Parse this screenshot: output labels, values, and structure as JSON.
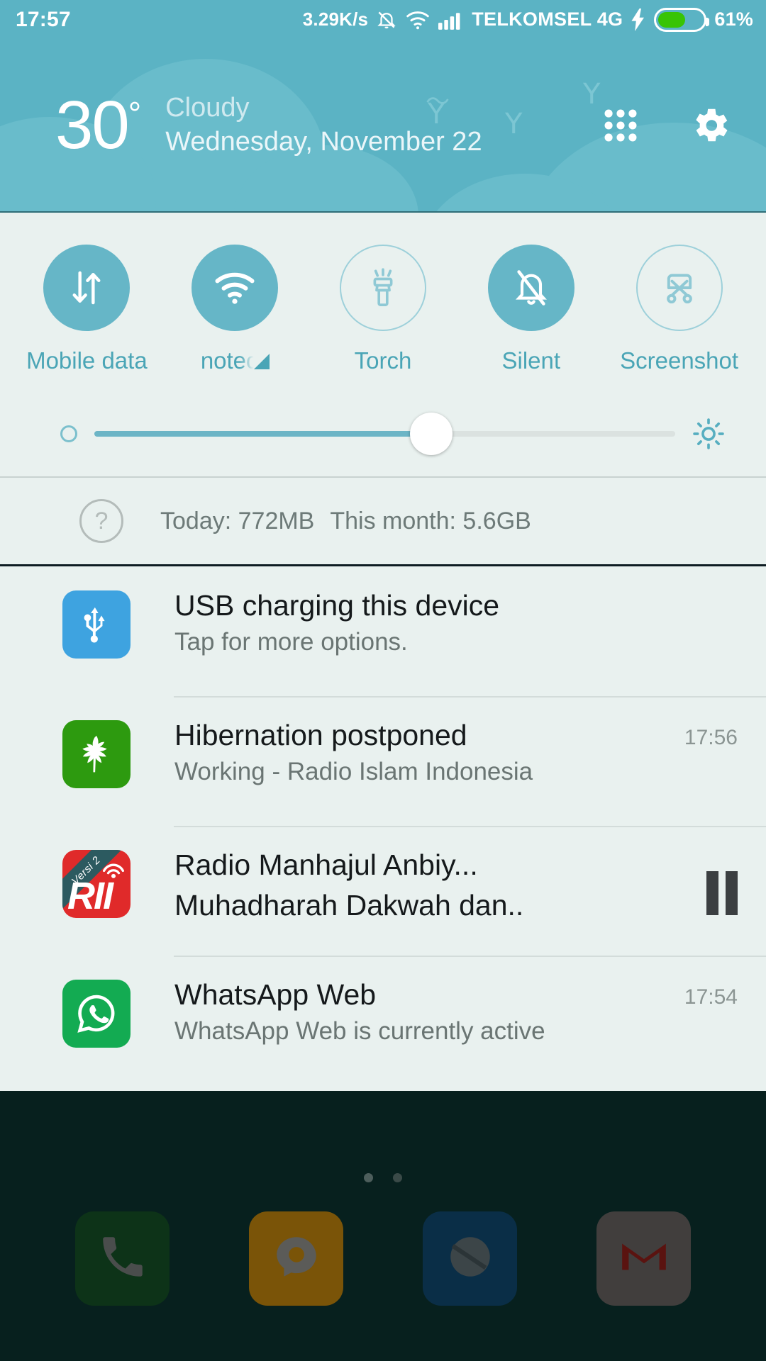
{
  "statusbar": {
    "clock": "17:57",
    "net_speed": "3.29K/s",
    "icons": [
      "silent-bell-icon",
      "wifi-icon",
      "signal-bars-icon"
    ],
    "carrier": "TELKOMSEL 4G",
    "charging_icon": "lightning-bolt-icon",
    "battery_percent": "61%",
    "battery_level": 61,
    "battery_color": "#38c404",
    "background_color": "#5bb3c4",
    "text_color": "#ffffff"
  },
  "weather": {
    "temperature": "30",
    "degree_symbol": "°",
    "condition": "Cloudy",
    "date": "Wednesday, November 22",
    "shortcuts_icon": "app-grid-icon",
    "settings_icon": "gear-icon",
    "background_color": "#5bb3c4"
  },
  "quick_settings": {
    "accent_color": "#66b6c7",
    "label_color": "#4aa5b6",
    "panel_background": "#e9f1ef",
    "tiles": [
      {
        "label": "Mobile data",
        "icon": "mobile-data-arrows-icon",
        "state": "on"
      },
      {
        "label": "notec",
        "icon": "wifi-icon",
        "state": "on"
      },
      {
        "label": "Torch",
        "icon": "flashlight-icon",
        "state": "off"
      },
      {
        "label": "Silent",
        "icon": "bell-slash-icon",
        "state": "on"
      },
      {
        "label": "Screenshot",
        "icon": "scissors-crop-icon",
        "state": "off"
      }
    ],
    "brightness": {
      "value_percent": 58,
      "low_icon": "brightness-low-icon",
      "high_icon": "brightness-high-sun-icon"
    },
    "data_usage": {
      "help_icon": "question-mark-icon",
      "today_label": "Today: 772MB",
      "month_label": "This month: 5.6GB"
    }
  },
  "notifications": [
    {
      "app_icon": "usb-icon",
      "icon_color": "#3ea3e0",
      "title": "USB charging this device",
      "text": "Tap for more options.",
      "time": "",
      "action": ""
    },
    {
      "app_icon": "leaf-icon",
      "icon_color": "#2d9a0f",
      "title": "Hibernation postponed",
      "text": "Working - Radio Islam Indonesia",
      "time": "17:56",
      "action": ""
    },
    {
      "app_icon": "rii-radio-icon",
      "icon_color": "#e02a2a",
      "icon_badge": "Versi 2",
      "icon_text": "RII",
      "title": "Radio Manhajul Anbiy...",
      "text": "Muhadharah Dakwah dan..",
      "time": "",
      "action": "pause-button"
    },
    {
      "app_icon": "whatsapp-icon",
      "icon_color": "#13ab52",
      "title": "WhatsApp Web",
      "text": "WhatsApp Web is currently active",
      "time": "17:54",
      "action": ""
    }
  ],
  "homescreen": {
    "page_dots": 2,
    "active_dot_index": 0,
    "dock": [
      {
        "label": "phone",
        "icon": "phone-icon",
        "color": "#0d3318"
      },
      {
        "label": "messaging",
        "icon": "message-bubble-icon",
        "color": "#7a5408"
      },
      {
        "label": "browser",
        "icon": "browser-globe-icon",
        "color": "#0a2e47"
      },
      {
        "label": "gmail",
        "icon": "gmail-envelope-icon",
        "color": "#413e3d"
      }
    ]
  }
}
